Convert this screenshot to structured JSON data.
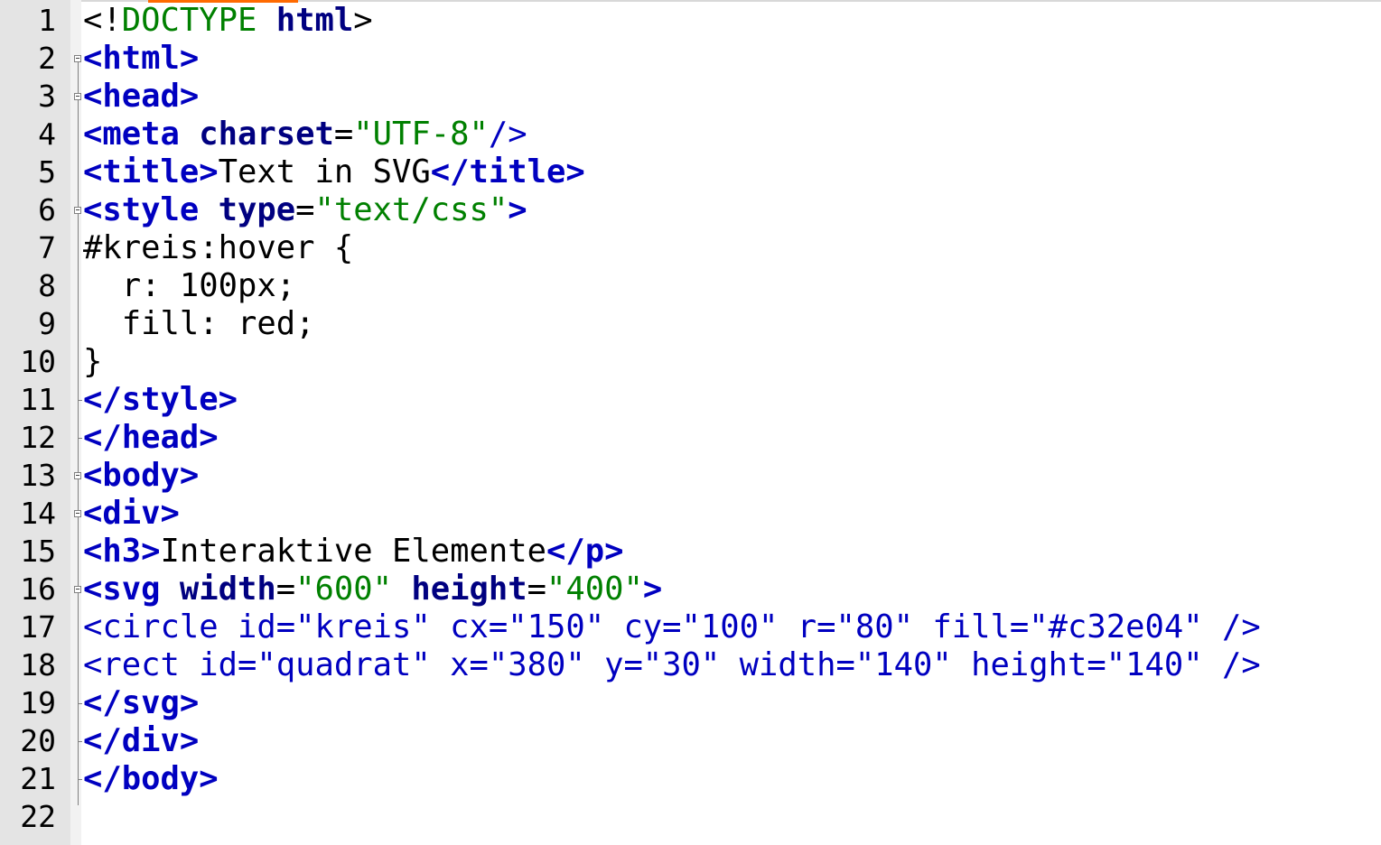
{
  "editor": {
    "line_numbers": [
      "1",
      "2",
      "3",
      "4",
      "5",
      "6",
      "7",
      "8",
      "9",
      "10",
      "11",
      "12",
      "13",
      "14",
      "15",
      "16",
      "17",
      "18",
      "19",
      "20",
      "21",
      "22"
    ],
    "lines": [
      [
        {
          "t": "<!",
          "c": "op"
        },
        {
          "t": "DOCTYPE",
          "c": "doct"
        },
        {
          "t": " ",
          "c": "op"
        },
        {
          "t": "html",
          "c": "kw"
        },
        {
          "t": ">",
          "c": "op"
        }
      ],
      [
        {
          "t": "<html>",
          "c": "tag"
        }
      ],
      [
        {
          "t": "<head>",
          "c": "tag"
        }
      ],
      [
        {
          "t": "<meta",
          "c": "tag"
        },
        {
          "t": " ",
          "c": "op"
        },
        {
          "t": "charset",
          "c": "attr"
        },
        {
          "t": "=",
          "c": "op"
        },
        {
          "t": "\"UTF-8\"",
          "c": "str"
        },
        {
          "t": "/>",
          "c": "plain-blue"
        }
      ],
      [
        {
          "t": "<title>",
          "c": "tag"
        },
        {
          "t": "Text in SVG",
          "c": "op"
        },
        {
          "t": "</title>",
          "c": "tag"
        }
      ],
      [
        {
          "t": "<style",
          "c": "tag"
        },
        {
          "t": " ",
          "c": "op"
        },
        {
          "t": "type",
          "c": "attr"
        },
        {
          "t": "=",
          "c": "op"
        },
        {
          "t": "\"text/css\"",
          "c": "str"
        },
        {
          "t": ">",
          "c": "tag"
        }
      ],
      [
        {
          "t": "#kreis:hover {",
          "c": "op"
        }
      ],
      [
        {
          "t": "  r: 100px;",
          "c": "op"
        }
      ],
      [
        {
          "t": "  fill: red;",
          "c": "op"
        }
      ],
      [
        {
          "t": "}",
          "c": "op"
        }
      ],
      [
        {
          "t": "</style>",
          "c": "tag"
        }
      ],
      [
        {
          "t": "</head>",
          "c": "tag"
        }
      ],
      [
        {
          "t": "<body>",
          "c": "tag"
        }
      ],
      [
        {
          "t": "<div>",
          "c": "tag"
        }
      ],
      [
        {
          "t": "<h3>",
          "c": "tag"
        },
        {
          "t": "Interaktive Elemente",
          "c": "op"
        },
        {
          "t": "</p>",
          "c": "tag"
        }
      ],
      [
        {
          "t": "<svg",
          "c": "tag"
        },
        {
          "t": " ",
          "c": "op"
        },
        {
          "t": "width",
          "c": "attr"
        },
        {
          "t": "=",
          "c": "op"
        },
        {
          "t": "\"600\"",
          "c": "str"
        },
        {
          "t": " ",
          "c": "op"
        },
        {
          "t": "height",
          "c": "attr"
        },
        {
          "t": "=",
          "c": "op"
        },
        {
          "t": "\"400\"",
          "c": "str"
        },
        {
          "t": ">",
          "c": "tag"
        }
      ],
      [
        {
          "t": "<circle id=\"kreis\" cx=\"150\" cy=\"100\" r=\"80\" fill=\"#c32e04\" />",
          "c": "plain-blue"
        }
      ],
      [
        {
          "t": "<rect id=\"quadrat\" x=\"380\" y=\"30\" width=\"140\" height=\"140\" />",
          "c": "plain-blue"
        }
      ],
      [
        {
          "t": "</svg>",
          "c": "tag"
        }
      ],
      [
        {
          "t": "</div>",
          "c": "tag"
        }
      ],
      [
        {
          "t": "</body>",
          "c": "tag"
        }
      ],
      []
    ]
  }
}
